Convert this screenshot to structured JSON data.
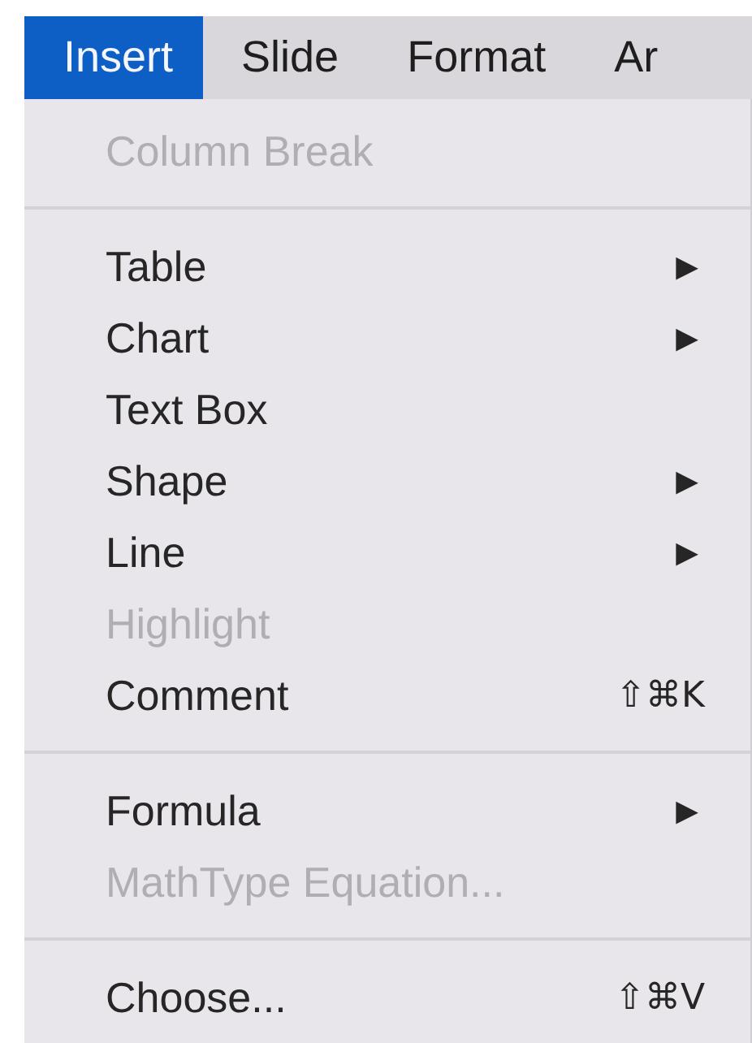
{
  "menu_bar": [
    {
      "label": "Insert",
      "selected": true
    },
    {
      "label": "Slide",
      "selected": false
    },
    {
      "label": "Format",
      "selected": false
    },
    {
      "label": "Ar",
      "selected": false
    }
  ],
  "menu": {
    "items": [
      {
        "kind": "item",
        "label": "Column Break",
        "disabled": true
      },
      {
        "kind": "separator"
      },
      {
        "kind": "item",
        "label": "Table",
        "disabled": false,
        "arrow": "▶"
      },
      {
        "kind": "item",
        "label": "Chart",
        "disabled": false,
        "arrow": "▶"
      },
      {
        "kind": "item",
        "label": "Text Box",
        "disabled": false
      },
      {
        "kind": "item",
        "label": "Shape",
        "disabled": false,
        "arrow": "▶"
      },
      {
        "kind": "item",
        "label": "Line",
        "disabled": false,
        "arrow": "▶"
      },
      {
        "kind": "item",
        "label": "Highlight",
        "disabled": true
      },
      {
        "kind": "item",
        "label": "Comment",
        "disabled": false,
        "shortcut": "⇧⌘K"
      },
      {
        "kind": "separator"
      },
      {
        "kind": "item",
        "label": "Formula",
        "disabled": false,
        "arrow": "▶"
      },
      {
        "kind": "item",
        "label": "MathType Equation...",
        "disabled": true
      },
      {
        "kind": "separator"
      },
      {
        "kind": "item",
        "label": "Choose...",
        "disabled": false,
        "shortcut": "⇧⌘V"
      }
    ]
  }
}
